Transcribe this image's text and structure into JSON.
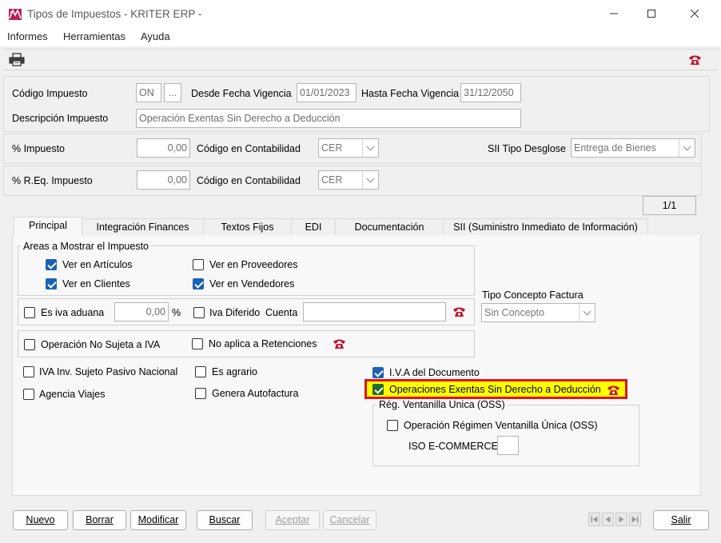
{
  "window": {
    "title": "Tipos de Impuestos - KRITER ERP -"
  },
  "menu": {
    "items": [
      "Informes",
      "Herramientas",
      "Ayuda"
    ]
  },
  "header": {
    "codigo_label": "Código Impuesto",
    "codigo_value": "ON",
    "codigo_btn": "...",
    "desde_label": "Desde Fecha Vigencia",
    "desde_value": "01/01/2023",
    "hasta_label": "Hasta Fecha Vigencia",
    "hasta_value": "31/12/2050",
    "descripcion_label": "Descripción Impuesto",
    "descripcion_value": "Operación Exentas Sin Derecho a Deducción"
  },
  "impuesto": {
    "pct_label": "% Impuesto",
    "pct_value": "0,00",
    "contab_label": "Código en Contabilidad",
    "contab_value": "CER",
    "sii_label": "SII Tipo Desglose",
    "sii_value": "Entrega de Bienes"
  },
  "req": {
    "pct_label": "% R.Eq. Impuesto",
    "pct_value": "0,00",
    "contab_label": "Código en Contabilidad",
    "contab_value": "CER"
  },
  "record_counter": "1/1",
  "tabs": [
    "Principal",
    "Integración Finances",
    "Textos Fijos",
    "EDI",
    "Documentación",
    "SII (Suministro Inmediato de Información)"
  ],
  "principal": {
    "areas_title": "Areas a Mostrar el Impuesto",
    "ver_articulos": "Ver en Artículos",
    "ver_clientes": "Ver en Clientes",
    "ver_proveedores": "Ver en Proveedores",
    "ver_vendedores": "Ver en Vendedores",
    "iva_aduana": "Es iva aduana",
    "iva_aduana_value": "0,00",
    "pct_sign": "%",
    "iva_diferido": "Iva Diferido",
    "cuenta_label": "Cuenta",
    "cuenta_value": "",
    "no_sujeta": "Operación No Sujeta a IVA",
    "no_retenciones": "No aplica a Retenciones",
    "tipo_concepto_label": "Tipo Concepto Factura",
    "tipo_concepto_value": "Sin Concepto",
    "iva_inv": "IVA Inv. Sujeto Pasivo Nacional",
    "agrario": "Es agrario",
    "agencia": "Agencia Viajes",
    "autofactura": "Genera Autofactura",
    "iva_documento": "I.V.A del Documento",
    "exentas": "Operaciones Exentas Sin Derecho a Deducción",
    "oss_title": "Rég. Ventanilla Unica (OSS)",
    "oss_option": "Operación Régimen Ventanilla Única (OSS)",
    "iso_label": "ISO E-COMMERCE",
    "iso_value": ""
  },
  "buttons": {
    "nuevo": "Nuevo",
    "borrar": "Borrar",
    "modificar": "Modificar",
    "buscar": "Buscar",
    "aceptar": "Aceptar",
    "cancelar": "Cancelar",
    "salir": "Salir"
  },
  "colors": {
    "accent": "#1a62b5",
    "highlight_fill": "#ffff00",
    "highlight_border": "#e0141e",
    "phone_red": "#c8102e"
  }
}
